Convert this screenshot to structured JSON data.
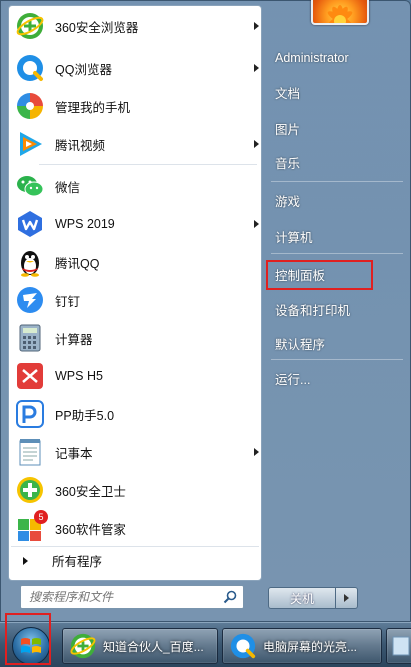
{
  "programs": [
    {
      "label": "360安全浏览器",
      "icon": "360-browser-icon",
      "has_submenu": true
    },
    {
      "label": "QQ浏览器",
      "icon": "qq-browser-icon",
      "has_submenu": true
    },
    {
      "label": "管理我的手机",
      "icon": "phone-manager-icon",
      "has_submenu": false
    },
    {
      "label": "腾讯视频",
      "icon": "tencent-video-icon",
      "has_submenu": true
    },
    {
      "label": "微信",
      "icon": "wechat-icon",
      "has_submenu": false
    },
    {
      "label": "WPS 2019",
      "icon": "wps-icon",
      "has_submenu": true
    },
    {
      "label": "腾讯QQ",
      "icon": "qq-penguin-icon",
      "has_submenu": false
    },
    {
      "label": "钉钉",
      "icon": "dingtalk-icon",
      "has_submenu": false
    },
    {
      "label": "计算器",
      "icon": "calculator-icon",
      "has_submenu": false
    },
    {
      "label": "WPS H5",
      "icon": "wps-h5-icon",
      "has_submenu": false
    },
    {
      "label": "PP助手5.0",
      "icon": "pp-assistant-icon",
      "has_submenu": false
    },
    {
      "label": "记事本",
      "icon": "notepad-icon",
      "has_submenu": true
    },
    {
      "label": "360安全卫士",
      "icon": "360-safe-icon",
      "has_submenu": false
    },
    {
      "label": "360软件管家",
      "icon": "360-software-icon",
      "has_submenu": false,
      "badge": "5"
    }
  ],
  "all_programs_label": "所有程序",
  "search": {
    "placeholder": "搜索程序和文件"
  },
  "right_items": {
    "user": "Administrator",
    "documents": "文档",
    "pictures": "图片",
    "music": "音乐",
    "games": "游戏",
    "computer": "计算机",
    "control_panel": "控制面板",
    "devices": "设备和打印机",
    "default_programs": "默认程序",
    "run": "运行..."
  },
  "shutdown_label": "关机",
  "taskbar": {
    "items": [
      {
        "label": "知道合伙人_百度...",
        "icon": "360-browser-icon"
      },
      {
        "label": "电脑屏幕的光亮...",
        "icon": "qq-browser-icon"
      }
    ]
  },
  "colors": {
    "highlight_red": "#e02020",
    "wps_red": "#e23c39",
    "wechat_green": "#2bb24c"
  }
}
